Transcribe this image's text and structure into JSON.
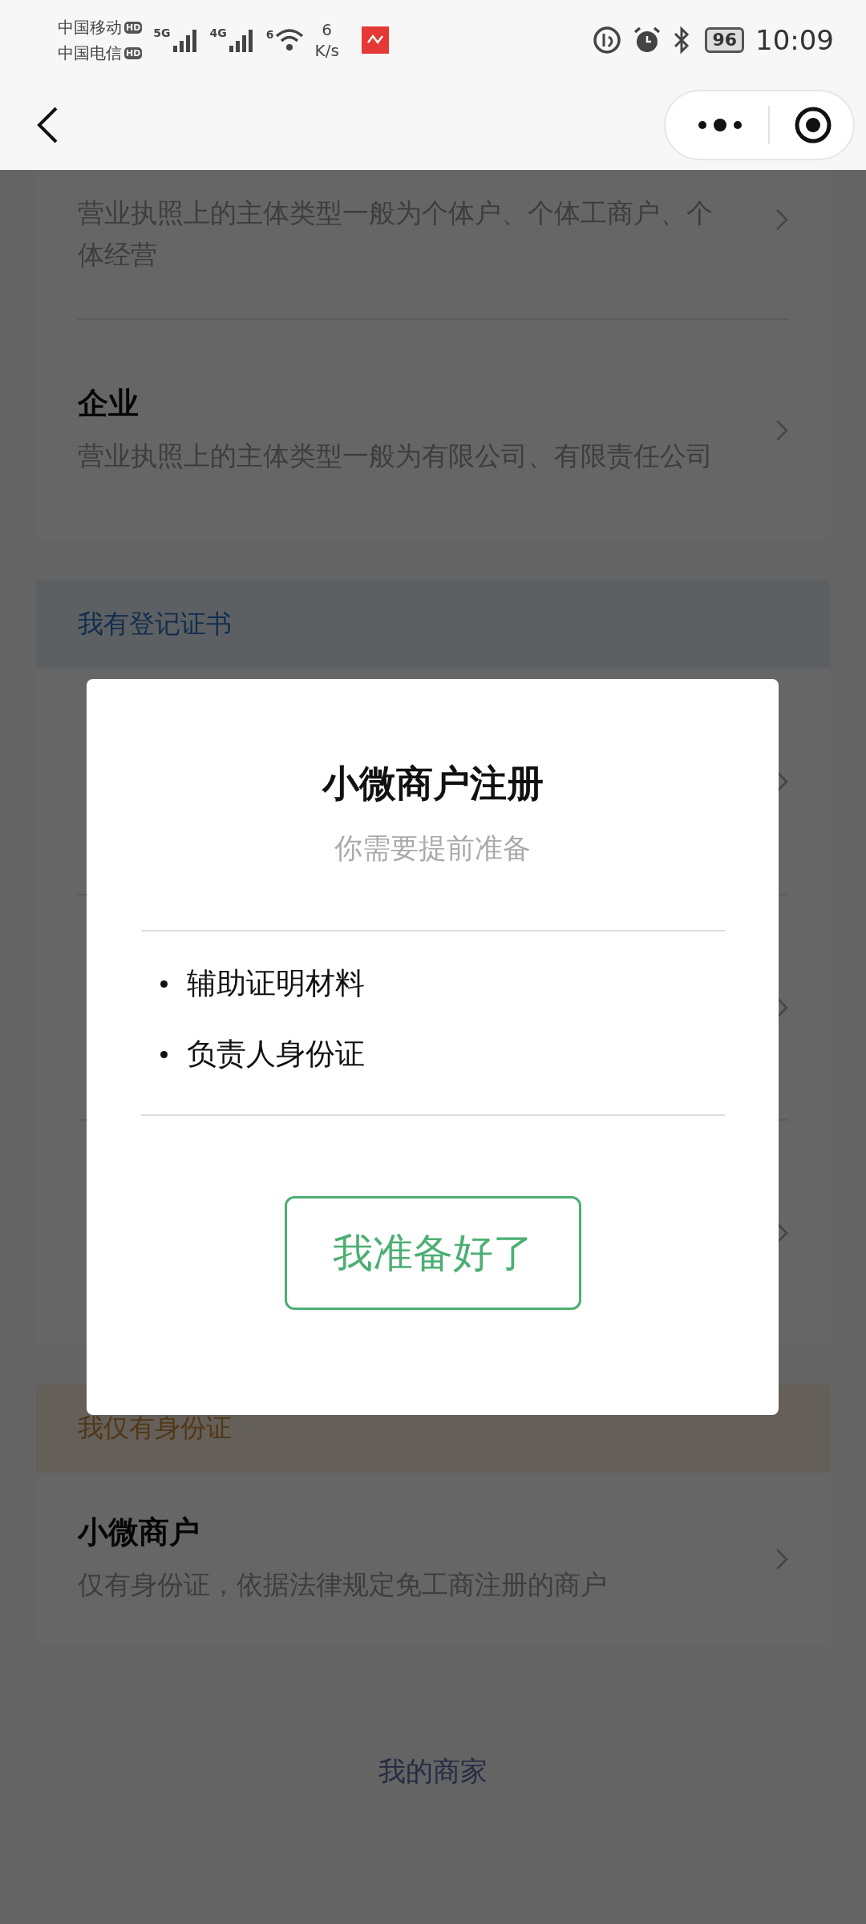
{
  "status_bar": {
    "carriers": [
      {
        "name": "中国移动",
        "badge": "HD"
      },
      {
        "name": "中国电信",
        "badge": "HD"
      }
    ],
    "networks": [
      {
        "label": "5G"
      },
      {
        "label": "4G"
      }
    ],
    "wifi_label": "6",
    "speed_value": "6",
    "speed_unit": "K/s",
    "battery": "96",
    "time": "10:09"
  },
  "sections": [
    {
      "items": [
        {
          "kind": "text",
          "description": "营业执照上的主体类型一般为个体户、个体工商户、个体经营"
        },
        {
          "kind": "text",
          "title": "企业",
          "description": "营业执照上的主体类型一般为有限公司、有限责任公司"
        }
      ]
    },
    {
      "kind": "blue",
      "header": "我有登记证书",
      "items": [
        {
          "kind": "covered"
        },
        {
          "kind": "covered"
        },
        {
          "kind": "covered"
        }
      ]
    },
    {
      "kind": "orange",
      "header": "我仅有身份证",
      "items": [
        {
          "kind": "text",
          "title": "小微商户",
          "description": "仅有身份证，依据法律规定免工商注册的商户"
        }
      ]
    }
  ],
  "footer_link": "我的商家",
  "modal": {
    "title": "小微商户注册",
    "subtitle": "你需要提前准备",
    "bullets": [
      "辅助证明材料",
      "负责人身份证"
    ],
    "button": "我准备好了"
  }
}
